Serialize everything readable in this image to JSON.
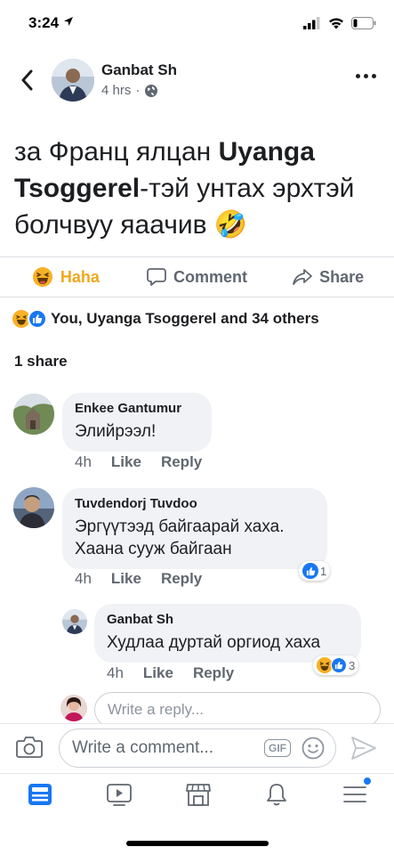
{
  "status_bar": {
    "time": "3:24"
  },
  "post": {
    "author": "Ganbat Sh",
    "time": "4 hrs",
    "text_before": "за Франц ялцан ",
    "tagged": "Uyanga Tsoggerel",
    "text_after": "-тэй унтах эрхтэй болчвуу яаачив",
    "emoji": "🤣"
  },
  "actions": {
    "haha": "Haha",
    "comment": "Comment",
    "share": "Share"
  },
  "reactions_summary": "You, Uyanga Tsoggerel and 34 others",
  "shares": "1 share",
  "comments": [
    {
      "name": "Enkee Gantumur",
      "text": "Элийрээл!",
      "time": "4h",
      "like": "Like",
      "reply": "Reply"
    },
    {
      "name": "Tuvdendorj Tuvdoo",
      "text_line1": "Эргүүтээд байгаарай хаха.",
      "text_line2": "Хаана сууж байгаан",
      "time": "4h",
      "like": "Like",
      "reply": "Reply",
      "reaction_count": "1"
    }
  ],
  "reply": {
    "name": "Ganbat Sh",
    "text": "Худлаа дуртай оргиод хаха",
    "time": "4h",
    "like": "Like",
    "reply": "Reply",
    "reaction_count": "3"
  },
  "reply_input_placeholder": "Write a reply...",
  "comment_input_placeholder": "Write a comment...",
  "gif_label": "GIF",
  "colors": {
    "facebook_blue": "#1877f2",
    "haha_yellow": "#f7b125",
    "gray_text": "#606770"
  },
  "icons": [
    "back-icon",
    "globe-icon",
    "more-icon",
    "haha-icon",
    "comment-icon",
    "share-icon",
    "like-icon",
    "camera-icon",
    "gif-icon",
    "smiley-icon",
    "send-icon",
    "feed-icon",
    "watch-icon",
    "marketplace-icon",
    "notifications-icon",
    "menu-icon"
  ]
}
